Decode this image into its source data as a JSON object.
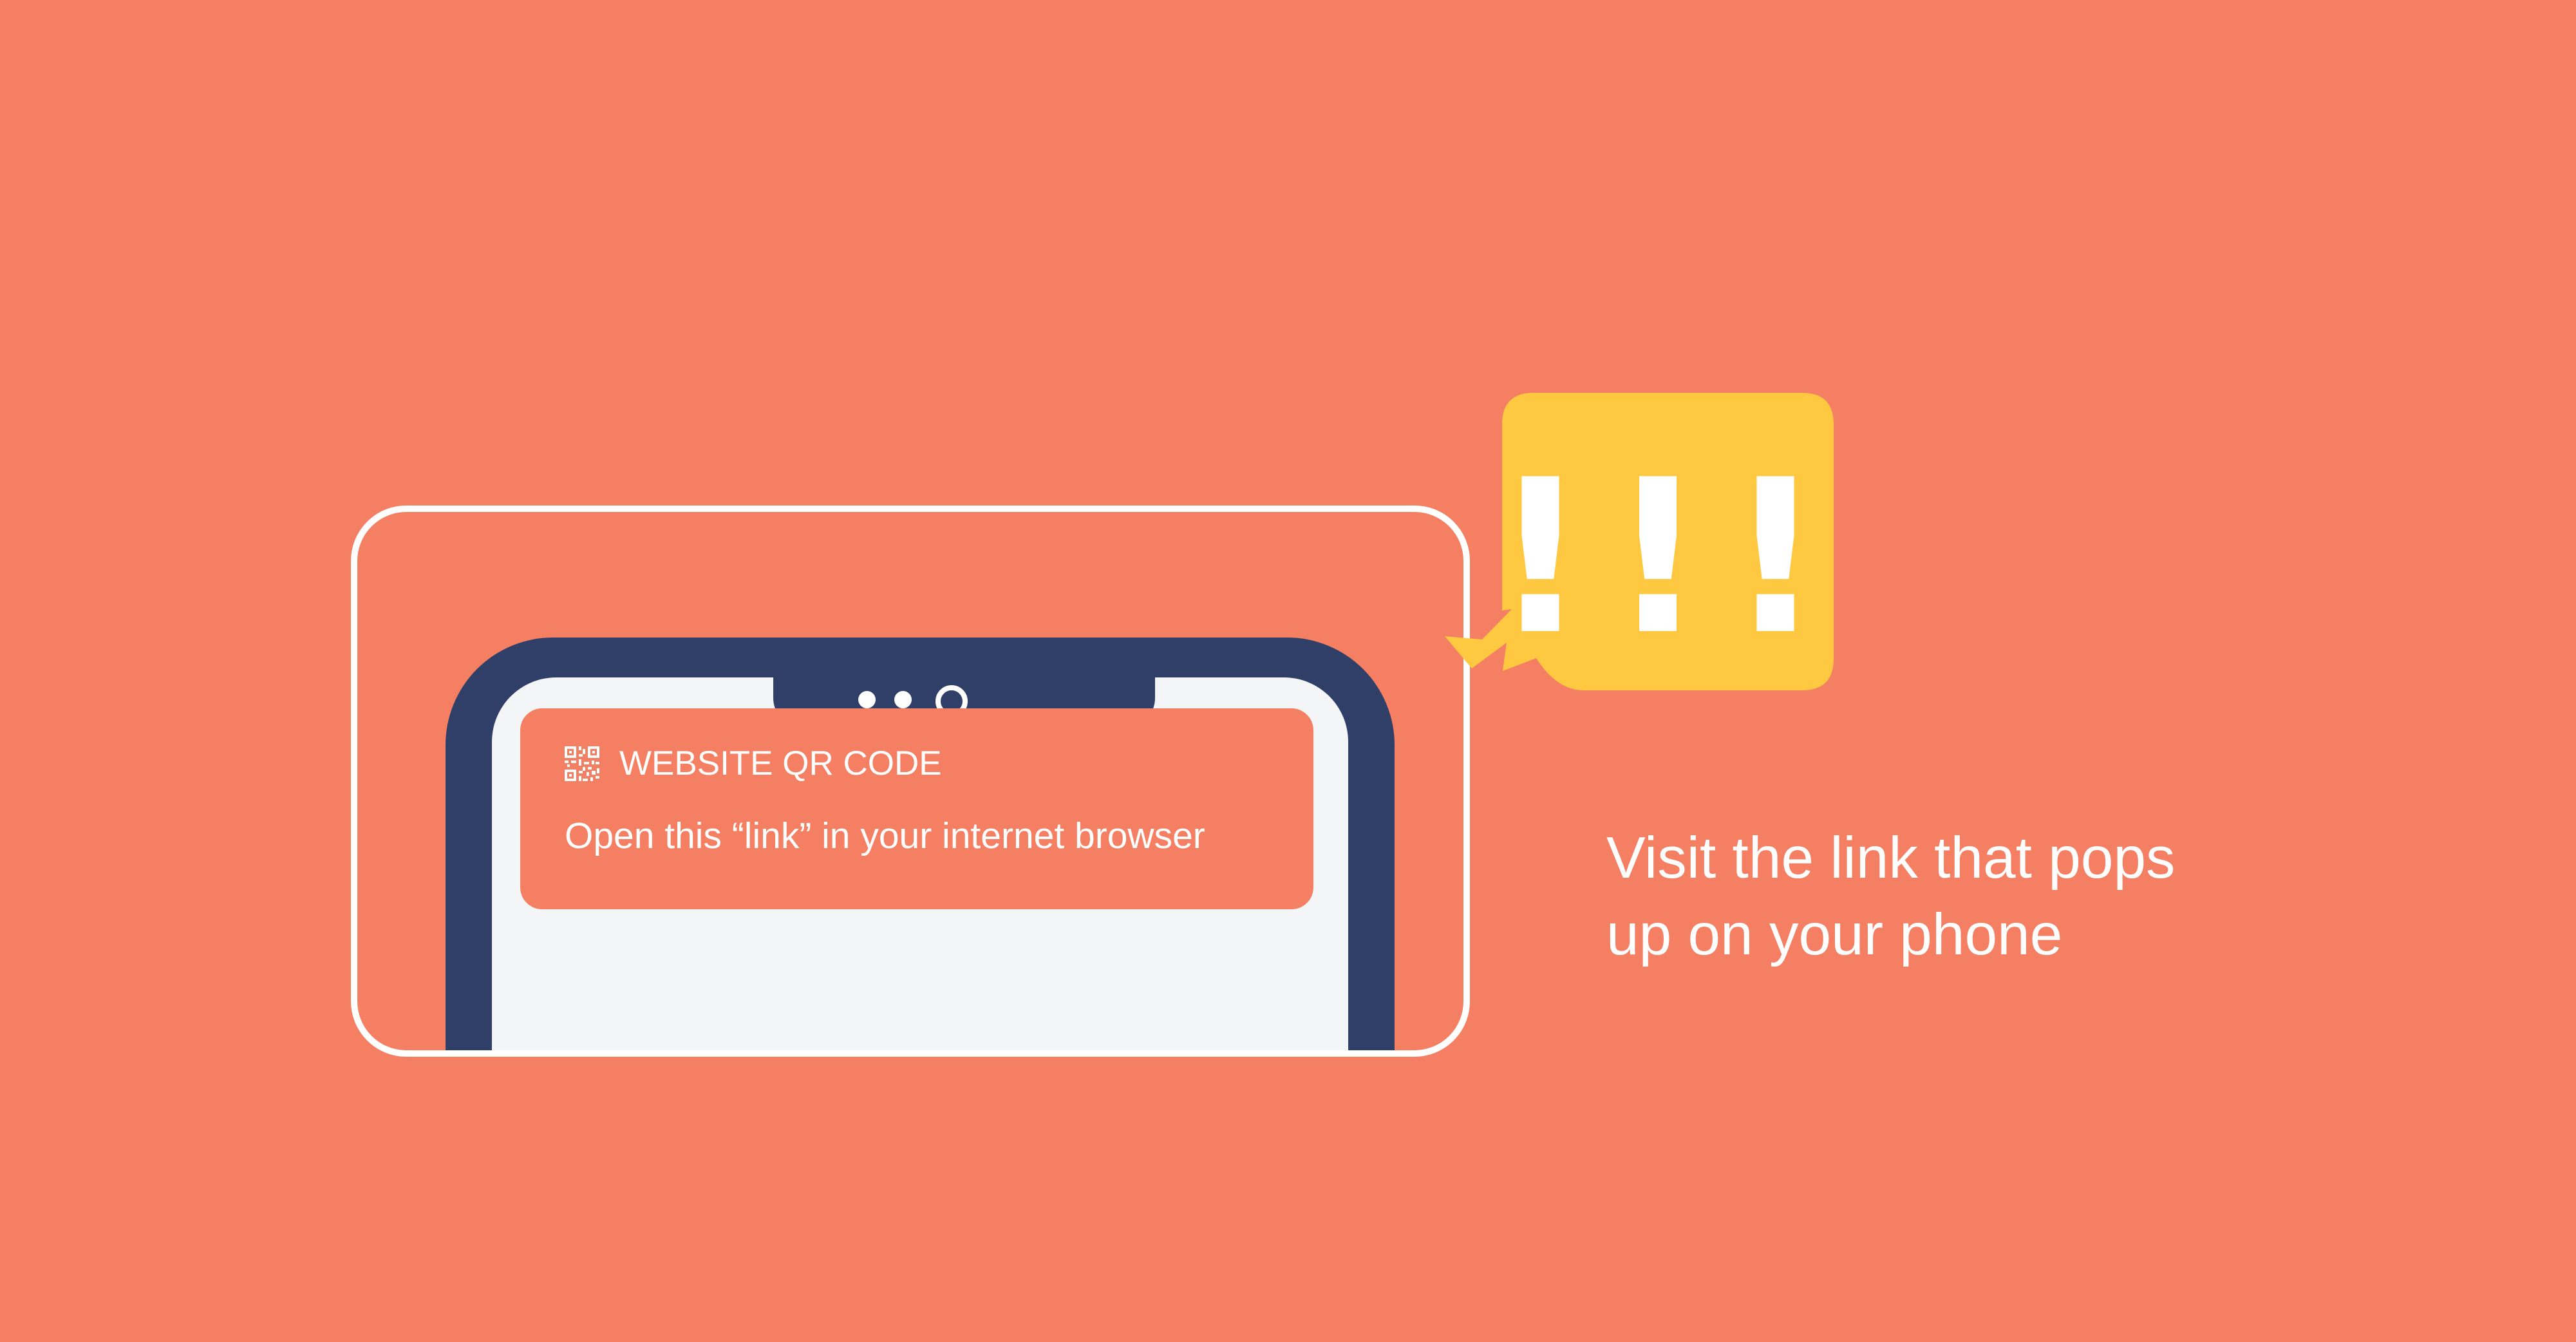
{
  "notification": {
    "app_name": "WEBSITE QR CODE",
    "message": "Open this “link” in your internet browser"
  },
  "alert": {
    "text": "!!!"
  },
  "caption": {
    "line1": "Visit the link that pops",
    "line2": "up on your phone"
  },
  "colors": {
    "background": "#F47F62",
    "phone_body": "#2F3F68",
    "phone_screen": "#F4F5F7",
    "alert_bubble": "#FEC840",
    "text": "#FFFFFF"
  },
  "icons": {
    "notification_icon": "qr-code-icon",
    "alert_icon": "exclamation-icon"
  }
}
